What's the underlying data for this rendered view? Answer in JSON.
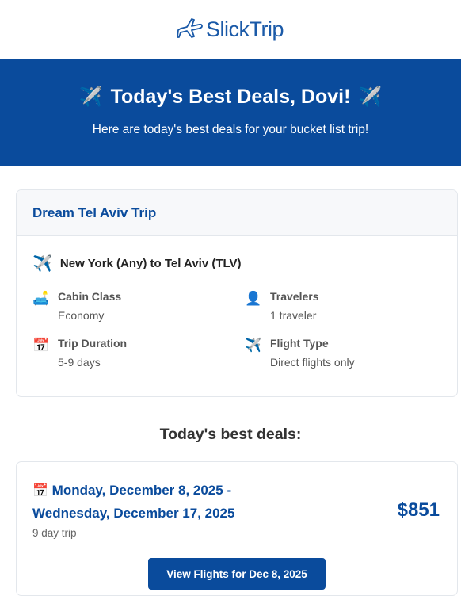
{
  "brand": {
    "name": "SlickTrip",
    "color": "#1b5aa8"
  },
  "hero": {
    "emoji_left": "✈️",
    "title": "Today's Best Deals, Dovi!",
    "emoji_right": "✈️",
    "subtitle": "Here are today's best deals for your bucket list trip!",
    "background": "#0a4b9c"
  },
  "trip": {
    "name": "Dream Tel Aviv Trip",
    "route_emoji": "✈️",
    "route": "New York (Any) to Tel Aviv (TLV)",
    "details": [
      {
        "icon": "sofa-icon",
        "emoji": "🛋️",
        "label": "Cabin Class",
        "value": "Economy"
      },
      {
        "icon": "person-icon",
        "emoji": "👤",
        "label": "Travelers",
        "value": "1 traveler"
      },
      {
        "icon": "calendar-icon",
        "emoji": "📅",
        "label": "Trip Duration",
        "value": "5-9 days"
      },
      {
        "icon": "airplane-icon",
        "emoji": "✈️",
        "label": "Flight Type",
        "value": "Direct flights only"
      }
    ]
  },
  "deals_heading": "Today's best deals:",
  "deals": [
    {
      "date_emoji": "📅",
      "dates_line1": "Monday, December 8, 2025 -",
      "dates_line2": "Wednesday, December 17, 2025",
      "duration": "9 day trip",
      "price": "$851",
      "button_label": "View Flights for Dec 8, 2025"
    }
  ]
}
